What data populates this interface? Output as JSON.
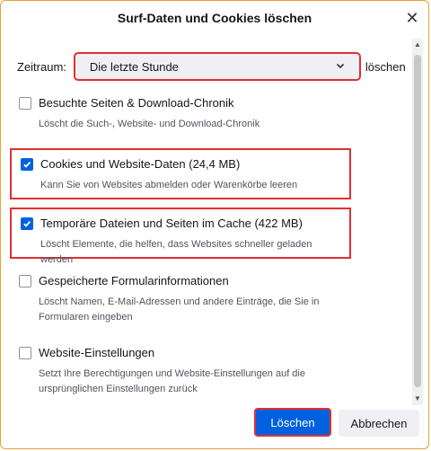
{
  "dialog": {
    "title": "Surf-Daten und Cookies löschen",
    "close_icon": "close-icon"
  },
  "time_range": {
    "label": "Zeitraum:",
    "selected": "Die letzte Stunde",
    "after_label": "löschen"
  },
  "items": [
    {
      "label": "Besuchte Seiten & Download-Chronik",
      "description": "Löscht die Such-, Website- und Download-Chronik",
      "checked": false
    },
    {
      "label": "Cookies und Website-Daten (24,4 MB)",
      "description": "Kann Sie von Websites abmelden oder Warenkörbe leeren",
      "checked": true
    },
    {
      "label": "Temporäre Dateien und Seiten im Cache (422 MB)",
      "description": "Löscht Elemente, die helfen, dass Websites schneller geladen werden",
      "checked": true
    },
    {
      "label": "Gespeicherte Formularinformationen",
      "description": "Löscht Namen, E-Mail-Adressen und andere Einträge, die Sie in Formularen eingeben",
      "checked": false
    },
    {
      "label": "Website-Einstellungen",
      "description": "Setzt Ihre Berechtigungen und Website-Einstellungen auf die ursprünglichen Einstellungen zurück",
      "checked": false
    }
  ],
  "buttons": {
    "clear": "Löschen",
    "cancel": "Abbrechen"
  },
  "colors": {
    "accent": "#0061e0",
    "highlight": "#e03030",
    "window_border": "#f0a030"
  }
}
